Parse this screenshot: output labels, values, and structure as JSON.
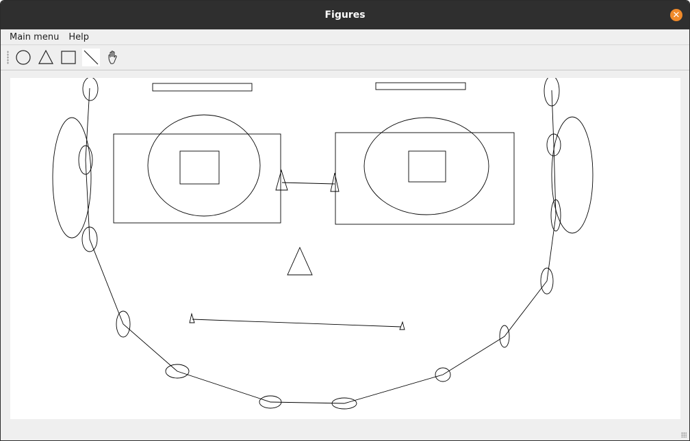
{
  "window": {
    "title": "Figures"
  },
  "menubar": {
    "items": [
      "Main menu",
      "Help"
    ]
  },
  "toolbar": {
    "tools": [
      "circle-tool",
      "triangle-tool",
      "rectangle-tool",
      "line-tool",
      "hand-tool"
    ],
    "selected": "line-tool"
  },
  "colors": {
    "titlebar": "#2f2f2f",
    "close": "#f08a2a",
    "stroke": "#000000"
  }
}
